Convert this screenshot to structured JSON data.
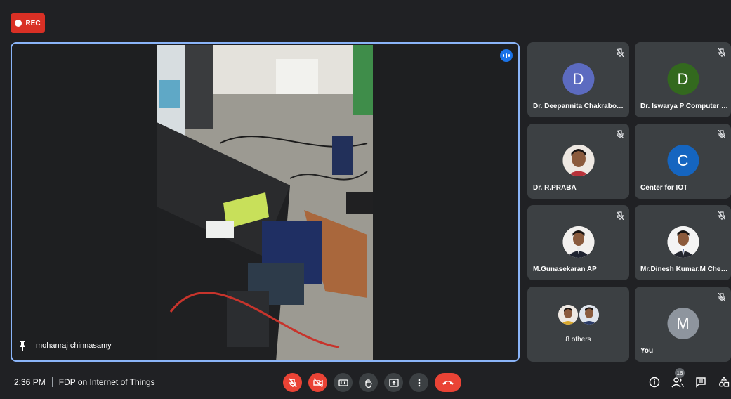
{
  "recording": {
    "label": "REC",
    "color": "#d93025"
  },
  "main_speaker": {
    "name": "mohanraj chinnasamy",
    "pin_icon": "pin-icon",
    "speaking_icon": "speaking-indicator-icon"
  },
  "participants": [
    {
      "name": "Dr. Deepannita Chakraborty",
      "initial": "D",
      "avatar_color": "#5c6bc0",
      "muted": true
    },
    {
      "name": "Dr. Iswarya P Computer Te...",
      "initial": "D",
      "avatar_color": "#33691e",
      "muted": true
    },
    {
      "name": "Dr. R.PRABA",
      "initial": "",
      "avatar_color": "#ece6e0",
      "muted": true
    },
    {
      "name": "Center for IOT",
      "initial": "C",
      "avatar_color": "#1565c0",
      "muted": true
    },
    {
      "name": "M.Gunasekaran AP",
      "initial": "",
      "avatar_color": "#ece6e0",
      "muted": true
    },
    {
      "name": "Mr.Dinesh Kumar.M Chem...",
      "initial": "",
      "avatar_color": "#ece6e0",
      "muted": true
    },
    {
      "name": "You",
      "initial": "M",
      "avatar_color": "#8e959e",
      "muted": true
    }
  ],
  "others": {
    "label": "8 others"
  },
  "bottom": {
    "time": "2:36 PM",
    "meeting_title": "FDP on Internet of Things",
    "controls": [
      "mic-off-icon",
      "camera-off-icon",
      "captions-icon",
      "raise-hand-icon",
      "present-icon",
      "more-options-icon",
      "end-call-icon"
    ],
    "right_icons": [
      "info-icon",
      "people-icon",
      "chat-icon",
      "activities-icon"
    ],
    "people_count": "16"
  }
}
